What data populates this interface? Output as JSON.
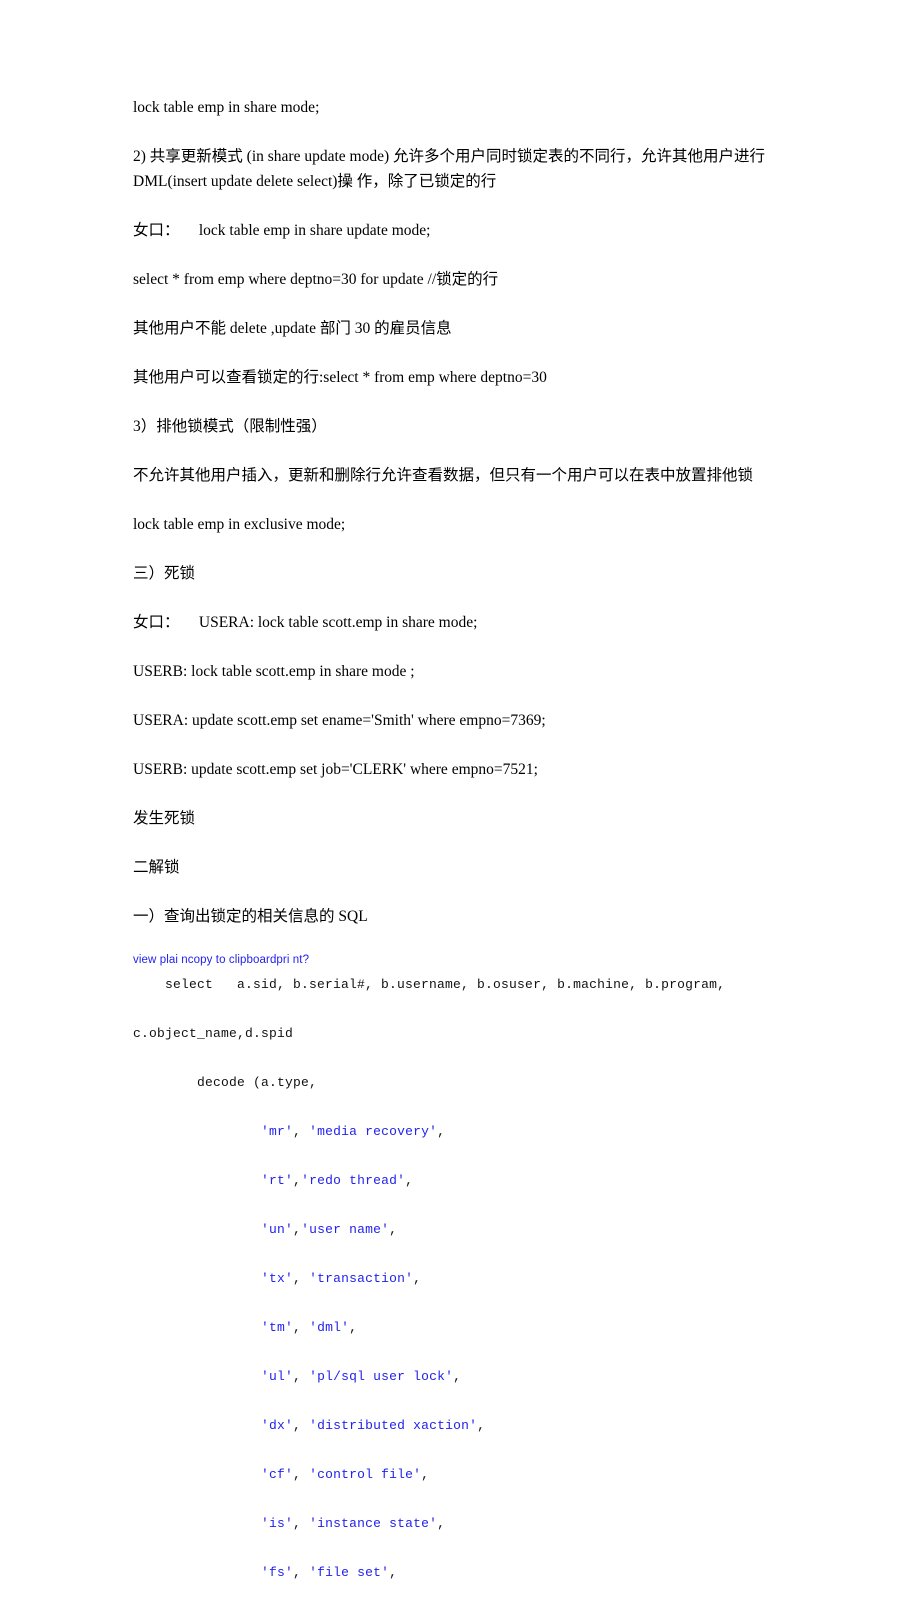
{
  "document": {
    "paragraphs": [
      {
        "id": "p1",
        "text": "lock table emp in share mode;"
      },
      {
        "id": "p2",
        "text": "2) 共享更新模式 (in share update mode) 允许多个用户同时锁定表的不同行，允许其他用户进行 DML(insert update delete select)操 作，除了已锁定的行"
      },
      {
        "id": "p3",
        "text": "女口： 　lock table emp in share update mode;"
      },
      {
        "id": "p4",
        "text": "select * from emp where deptno=30 for update //锁定的行"
      },
      {
        "id": "p5",
        "text": "其他用户不能 delete ,update 部门 30 的雇员信息"
      },
      {
        "id": "p6",
        "text": "其他用户可以查看锁定的行:select * from emp where deptno=30"
      },
      {
        "id": "p7",
        "text": "3）排他锁模式（限制性强）"
      },
      {
        "id": "p8",
        "text": "不允许其他用户插入，更新和删除行允许查看数据，但只有一个用户可以在表中放置排他锁"
      },
      {
        "id": "p9",
        "text": "lock table emp in exclusive mode;"
      },
      {
        "id": "p10",
        "text": "三）死锁"
      },
      {
        "id": "p11",
        "text": "女口： 　USERA: lock table scott.emp in share mode;"
      },
      {
        "id": "p12",
        "text": "USERB: lock table scott.emp in share mode ;"
      },
      {
        "id": "p13",
        "text": "USERA: update scott.emp set ename='Smith' where empno=7369;"
      },
      {
        "id": "p14",
        "text": "USERB: update scott.emp set job='CLERK' where empno=7521;"
      },
      {
        "id": "p15",
        "text": "发生死锁"
      },
      {
        "id": "p16",
        "text": "二解锁"
      },
      {
        "id": "p17",
        "text": "一）查询出锁定的相关信息的 SQL"
      }
    ],
    "code_toolbar": {
      "text": "view plai ncopy to clipboardpri nt?",
      "color": "#2222ee"
    },
    "code": {
      "language": "sql",
      "string_color": "#2222ee",
      "text_color": "#111111",
      "lines": [
        {
          "indent": 4,
          "plain": "select   a.sid, b.serial#, b.username, b.osuser, b.machine, b.program,"
        },
        {
          "indent": 0,
          "plain": "c.object_name,d.spid"
        },
        {
          "indent": 8,
          "plain": "decode (a.type,"
        },
        {
          "indent": 16,
          "key": "'mr'",
          "sep": ", ",
          "val": "'media recovery'",
          "tail": ","
        },
        {
          "indent": 16,
          "key": "'rt'",
          "sep": ",",
          "val": "'redo thread'",
          "tail": ","
        },
        {
          "indent": 16,
          "key": "'un'",
          "sep": ",",
          "val": "'user name'",
          "tail": ","
        },
        {
          "indent": 16,
          "key": "'tx'",
          "sep": ", ",
          "val": "'transaction'",
          "tail": ","
        },
        {
          "indent": 16,
          "key": "'tm'",
          "sep": ", ",
          "val": "'dml'",
          "tail": ","
        },
        {
          "indent": 16,
          "key": "'ul'",
          "sep": ", ",
          "val": "'pl/sql user lock'",
          "tail": ","
        },
        {
          "indent": 16,
          "key": "'dx'",
          "sep": ", ",
          "val": "'distributed xaction'",
          "tail": ","
        },
        {
          "indent": 16,
          "key": "'cf'",
          "sep": ", ",
          "val": "'control file'",
          "tail": ","
        },
        {
          "indent": 16,
          "key": "'is'",
          "sep": ", ",
          "val": "'instance state'",
          "tail": ","
        },
        {
          "indent": 16,
          "key": "'fs'",
          "sep": ", ",
          "val": "'file set'",
          "tail": ","
        }
      ]
    }
  }
}
